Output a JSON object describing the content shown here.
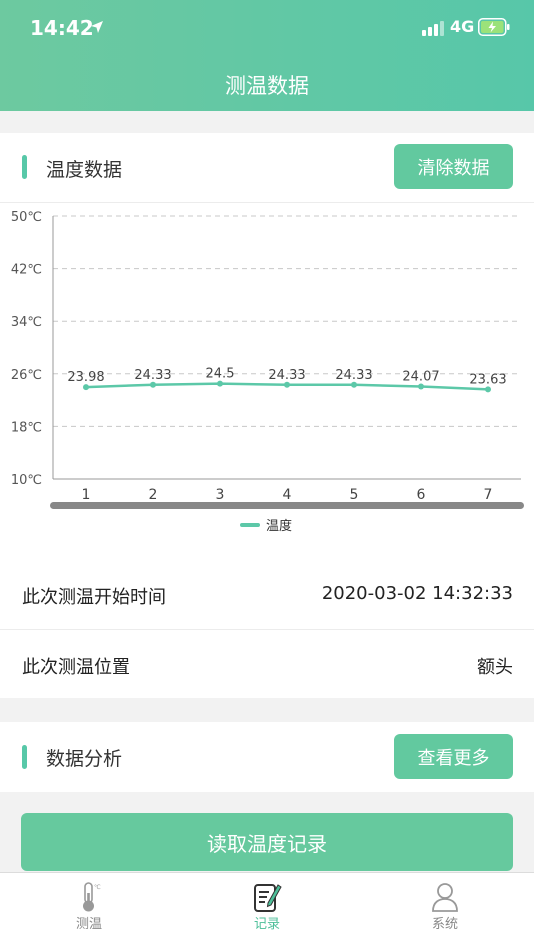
{
  "status": {
    "time": "14:42",
    "network": "4G"
  },
  "header": {
    "title": "测温数据"
  },
  "temp_section": {
    "title": "温度数据",
    "clear_button": "清除数据"
  },
  "chart_data": {
    "type": "line",
    "x": [
      1,
      2,
      3,
      4,
      5,
      6,
      7
    ],
    "series": [
      {
        "name": "温度",
        "values": [
          23.98,
          24.33,
          24.5,
          24.33,
          24.33,
          24.07,
          23.63
        ],
        "color": "#5cc8a8"
      }
    ],
    "y_ticks": [
      "10℃",
      "18℃",
      "26℃",
      "34℃",
      "42℃",
      "50℃"
    ],
    "ylim": [
      10,
      50
    ],
    "grid": "dashed horizontal",
    "legend": "bottom-center"
  },
  "info": {
    "start_time_label": "此次测温开始时间",
    "start_time_value": "2020-03-02 14:32:33",
    "position_label": "此次测温位置",
    "position_value": "额头"
  },
  "analysis": {
    "title": "数据分析",
    "more_button": "查看更多"
  },
  "read_button": "读取温度记录",
  "tabs": [
    {
      "label": "测温",
      "active": false
    },
    {
      "label": "记录",
      "active": true
    },
    {
      "label": "系统",
      "active": false
    }
  ],
  "colors": {
    "accent": "#57c8a8",
    "button": "#62c99f"
  }
}
